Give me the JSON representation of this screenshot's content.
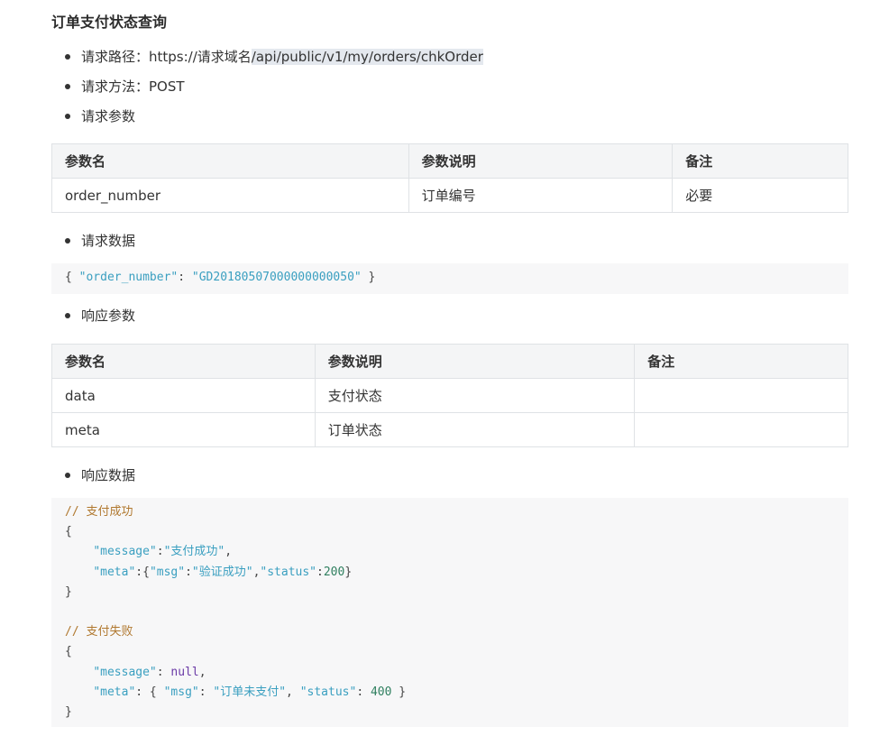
{
  "doc": {
    "title": "订单支付状态查询",
    "bullets": {
      "path_prefix": "请求路径：https://请求域名",
      "path_highlight": "/api/public/v1/my/orders/chkOrder",
      "method": "请求方法：POST",
      "req_params": "请求参数",
      "req_data": "请求数据",
      "resp_params": "响应参数",
      "resp_data": "响应数据"
    },
    "request_table": {
      "headers": [
        "参数名",
        "参数说明",
        "备注"
      ],
      "rows": [
        [
          "order_number",
          "订单编号",
          "必要"
        ]
      ]
    },
    "request_code": {
      "open": "{ ",
      "key": "\"order_number\"",
      "colon": ": ",
      "value": "\"GD20180507000000000050\"",
      "close": " }"
    },
    "response_table": {
      "headers": [
        "参数名",
        "参数说明",
        "备注"
      ],
      "rows": [
        [
          "data",
          "支付状态",
          ""
        ],
        [
          "meta",
          "订单状态",
          ""
        ]
      ]
    },
    "response_code": {
      "comment_success": "// 支付成功",
      "brace_open": "{",
      "s_message_key": "\"message\"",
      "s_message_colon": ":",
      "s_message_val": "\"支付成功\"",
      "s_comma": ",",
      "s_meta_key": "\"meta\"",
      "s_meta_colon": ":{",
      "s_msg_key": "\"msg\"",
      "s_msg_colon": ":",
      "s_msg_val": "\"验证成功\"",
      "s_comma2": ",",
      "s_status_key": "\"status\"",
      "s_status_colon": ":",
      "s_status_val": "200",
      "s_meta_close": "}",
      "brace_close": "}",
      "comment_fail": "// 支付失败",
      "f_message_key": "\"message\"",
      "f_message_colon": ": ",
      "f_message_val": "null",
      "f_comma": ",",
      "f_meta_key": "\"meta\"",
      "f_meta_colon": ": { ",
      "f_msg_key": "\"msg\"",
      "f_msg_colon": ": ",
      "f_msg_val": "\"订单未支付\"",
      "f_comma2": ", ",
      "f_status_key": "\"status\"",
      "f_status_colon": ": ",
      "f_status_val": "400",
      "f_meta_close": " }"
    }
  }
}
